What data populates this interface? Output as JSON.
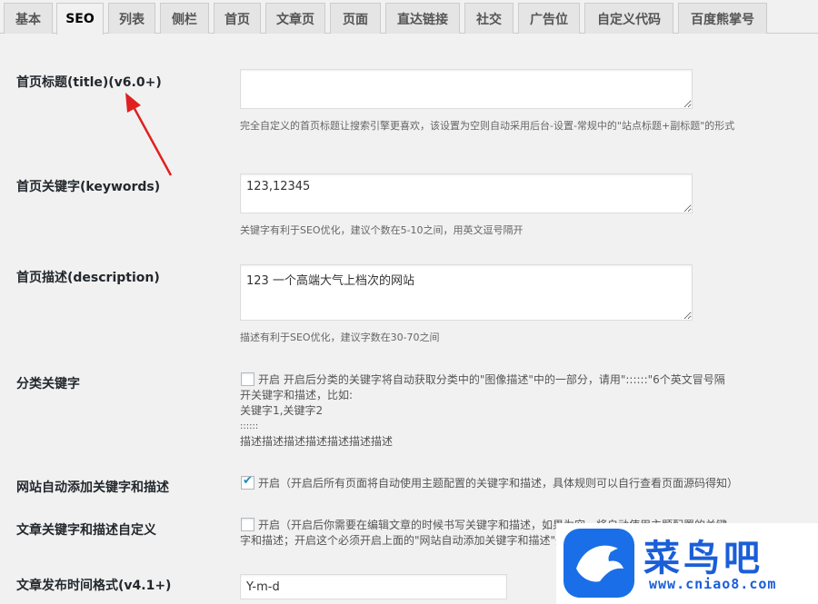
{
  "tabs": [
    {
      "label": "基本",
      "active": false
    },
    {
      "label": "SEO",
      "active": true
    },
    {
      "label": "列表",
      "active": false
    },
    {
      "label": "侧栏",
      "active": false
    },
    {
      "label": "首页",
      "active": false
    },
    {
      "label": "文章页",
      "active": false
    },
    {
      "label": "页面",
      "active": false
    },
    {
      "label": "直达链接",
      "active": false
    },
    {
      "label": "社交",
      "active": false
    },
    {
      "label": "广告位",
      "active": false
    },
    {
      "label": "自定义代码",
      "active": false
    },
    {
      "label": "百度熊掌号",
      "active": false
    }
  ],
  "settings": {
    "home_title": {
      "label": "首页标题(title)(v6.0+)",
      "value": "",
      "desc": "完全自定义的首页标题让搜索引擎更喜欢，该设置为空则自动采用后台-设置-常规中的\"站点标题+副标题\"的形式"
    },
    "home_keywords": {
      "label": "首页关键字(keywords)",
      "value": "123,12345",
      "desc": "关键字有利于SEO优化，建议个数在5-10之间，用英文逗号隔开"
    },
    "home_description": {
      "label": "首页描述(description)",
      "value": "123 一个高端大气上档次的网站",
      "desc": "描述有利于SEO优化，建议字数在30-70之间"
    },
    "category_keywords": {
      "label": "分类关键字",
      "checked": false,
      "text": "开启 开启后分类的关键字将自动获取分类中的\"图像描述\"中的一部分，请用\"::::::\"6个英文冒号隔开关键字和描述，比如:",
      "example_line1": "关键字1,关键字2",
      "example_line2": "::::::",
      "example_line3": "描述描述描述描述描述描述描述"
    },
    "auto_keywords": {
      "label": "网站自动添加关键字和描述",
      "checked": true,
      "text": "开启（开启后所有页面将自动使用主题配置的关键字和描述，具体规则可以自行查看页面源码得知）"
    },
    "post_custom": {
      "label": "文章关键字和描述自定义",
      "checked": false,
      "text": "开启（开启后你需要在编辑文章的时候书写关键字和描述，如果为空，将自动使用主题配置的关键字和描述；开启这个必须开启上面的\"网站自动添加关键字和描述\"开启）"
    },
    "date_format": {
      "label": "文章发布时间格式(v4.1+)",
      "value": "Y-m-d"
    }
  },
  "watermark": {
    "title": "菜鸟吧",
    "url": "www.cniao8.com"
  },
  "colors": {
    "accent": "#1e8cbe",
    "arrow": "#e02020",
    "watermark": "#1a5ed8"
  }
}
